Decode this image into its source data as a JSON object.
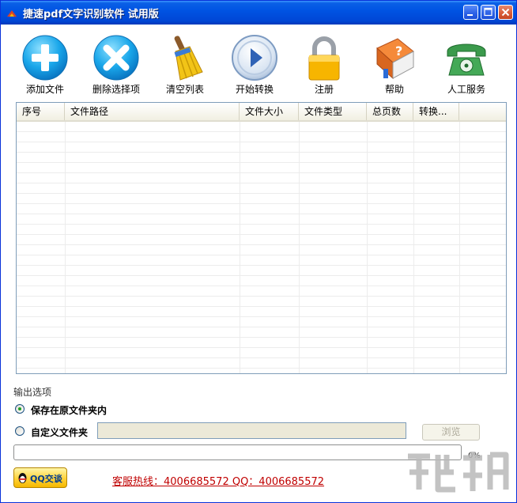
{
  "window": {
    "title": "捷速pdf文字识别软件  试用版"
  },
  "toolbar": {
    "items": [
      {
        "label": "添加文件",
        "icon": "add-icon"
      },
      {
        "label": "删除选择项",
        "icon": "delete-icon"
      },
      {
        "label": "清空列表",
        "icon": "broom-icon"
      },
      {
        "label": "开始转换",
        "icon": "play-icon"
      },
      {
        "label": "注册",
        "icon": "lock-icon"
      },
      {
        "label": "帮助",
        "icon": "help-book-icon"
      },
      {
        "label": "人工服务",
        "icon": "telephone-icon"
      }
    ]
  },
  "file_list": {
    "columns": [
      "序号",
      "文件路径",
      "文件大小",
      "文件类型",
      "总页数",
      "转换..."
    ],
    "rows": []
  },
  "output": {
    "section_label": "输出选项",
    "option_original": "保存在原文件夹内",
    "option_custom": "自定义文件夹",
    "custom_path": "",
    "browse_label": "浏览",
    "selected": "original"
  },
  "progress": {
    "percent_label": "0%",
    "value": 0
  },
  "footer": {
    "qq_label": "QQ交谈",
    "hotline": "客服热线：4006685572 QQ：4006685572"
  },
  "colors": {
    "titlebar": "#0054e3",
    "hotline": "#c00000",
    "accent_green": "#21a121"
  }
}
